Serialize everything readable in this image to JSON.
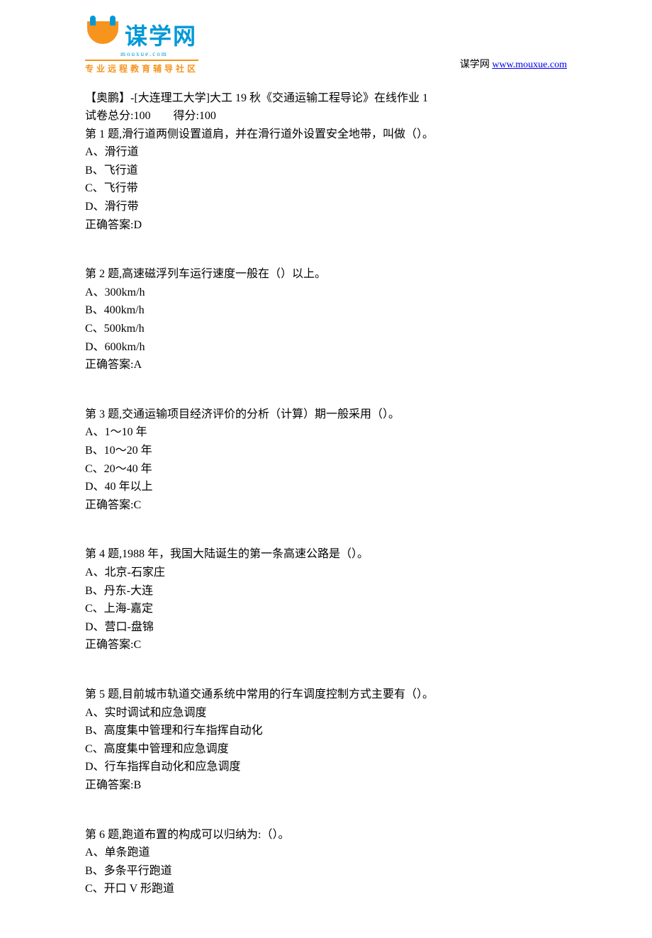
{
  "header": {
    "logo_cn": "谋学网",
    "logo_en": "mouxue.com",
    "tagline": "专业远程教育辅导社区",
    "site_label": "谋学网 ",
    "site_url": "www.mouxue.com"
  },
  "title": "【奥鹏】-[大连理工大学]大工 19 秋《交通运输工程导论》在线作业 1",
  "score_line": "试卷总分:100  得分:100",
  "questions": [
    {
      "stem": "第 1 题,滑行道两侧设置道肩，并在滑行道外设置安全地带，叫做（）。",
      "options": [
        "A、滑行道",
        "B、飞行道",
        "C、飞行带",
        "D、滑行带"
      ],
      "answer": "正确答案:D"
    },
    {
      "stem": "第 2 题,高速磁浮列车运行速度一般在（）以上。",
      "options": [
        "A、300km/h",
        "B、400km/h",
        "C、500km/h",
        "D、600km/h"
      ],
      "answer": "正确答案:A"
    },
    {
      "stem": "第 3 题,交通运输项目经济评价的分析（计算）期一般采用（）。",
      "options": [
        "A、1～10 年",
        "B、10～20 年",
        "C、20～40 年",
        "D、40 年以上"
      ],
      "answer": "正确答案:C"
    },
    {
      "stem": "第 4 题,1988 年，我国大陆诞生的第一条高速公路是（）。",
      "options": [
        "A、北京-石家庄",
        "B、丹东-大连",
        "C、上海-嘉定",
        "D、营口-盘锦"
      ],
      "answer": "正确答案:C"
    },
    {
      "stem": "第 5 题,目前城市轨道交通系统中常用的行车调度控制方式主要有（）。",
      "options": [
        "A、实时调试和应急调度",
        "B、高度集中管理和行车指挥自动化",
        "C、高度集中管理和应急调度",
        "D、行车指挥自动化和应急调度"
      ],
      "answer": "正确答案:B"
    },
    {
      "stem": "第 6 题,跑道布置的构成可以归纳为:（）。",
      "options": [
        "A、单条跑道",
        "B、多条平行跑道",
        "C、开口 V 形跑道"
      ],
      "answer": ""
    }
  ]
}
